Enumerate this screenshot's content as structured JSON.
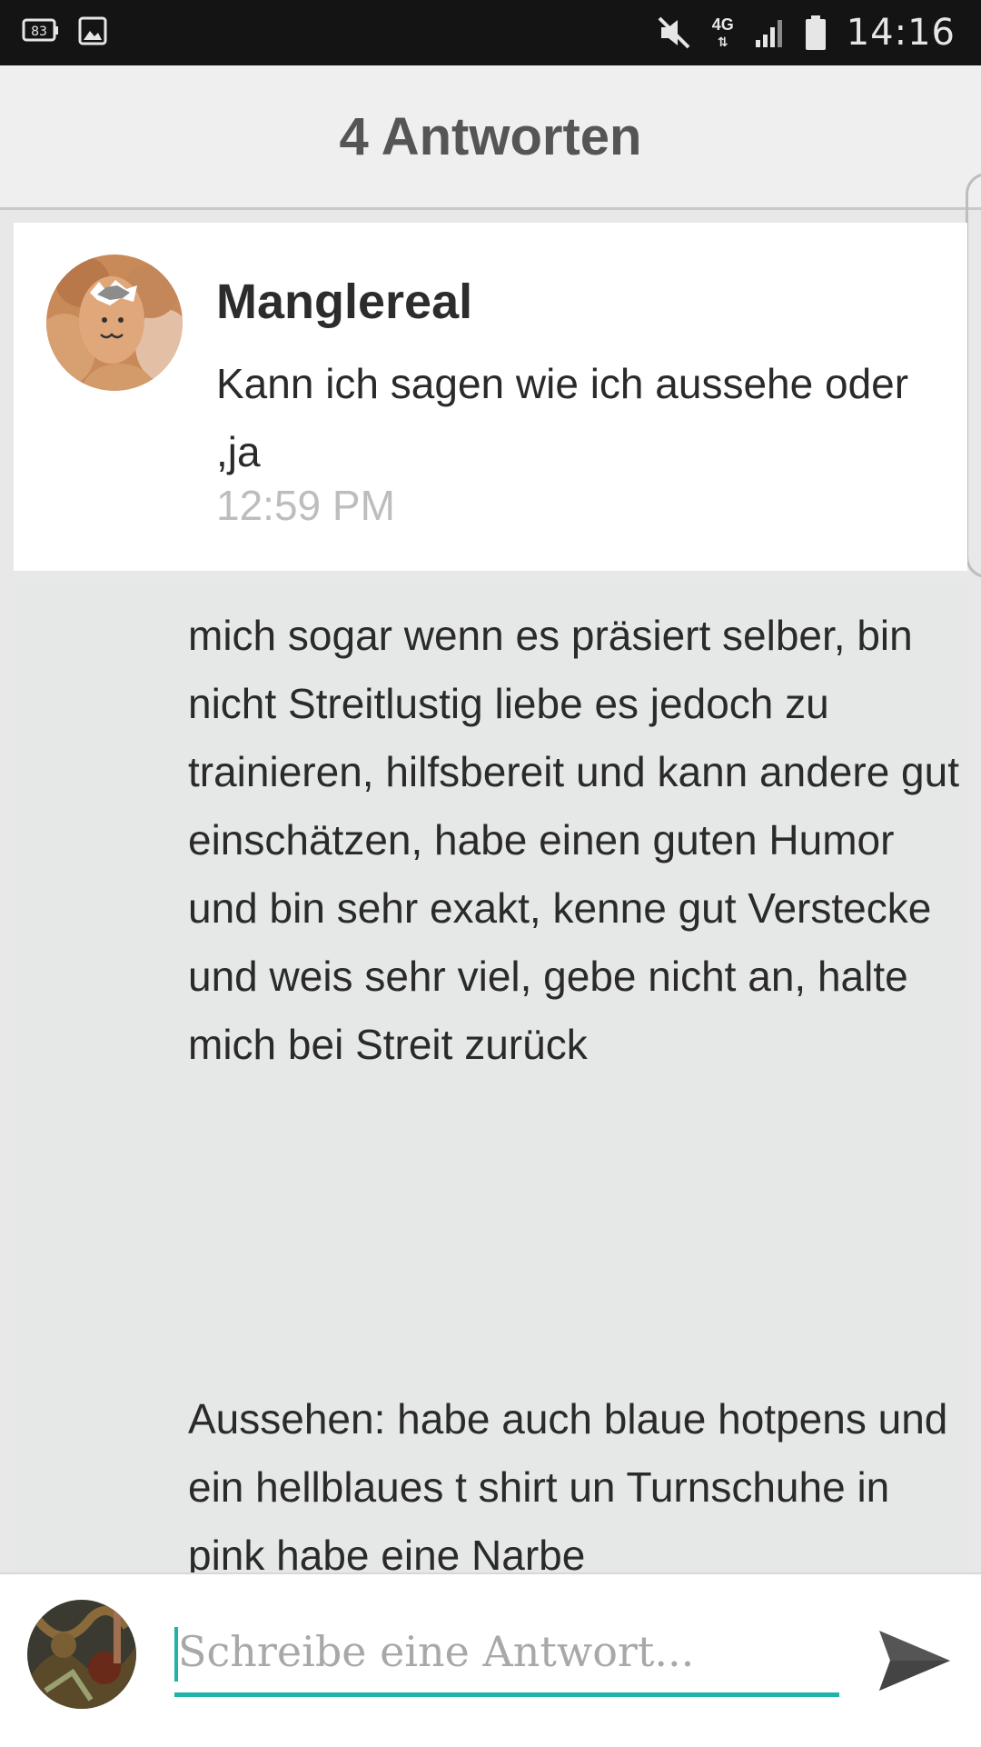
{
  "status_bar": {
    "left_badge": "83",
    "network": "4G",
    "time": "14:16"
  },
  "header": {
    "title": "4 Antworten"
  },
  "comment": {
    "author": "Manglereal",
    "text": "Kann ich sagen wie ich aussehe oder ,ja",
    "time": "12:59 PM"
  },
  "reply": {
    "paragraph1": "mich sogar wenn es präsiert selber, bin nicht Streitlustig liebe es jedoch zu trainieren, hilfsbereit und kann andere gut einschätzen, habe einen guten Humor und bin sehr exakt, kenne gut Verstecke und weis sehr viel, gebe nicht an, halte mich bei Streit zurück",
    "paragraph2": "Aussehen: habe auch blaue hotpens und ein hellblaues t shirt un Turnschuhe in pink habe eine Narbe"
  },
  "composer": {
    "placeholder": "Schreibe eine Antwort..."
  },
  "icons": {
    "mute": "mute-icon",
    "signal": "signal-icon",
    "battery": "battery-icon",
    "send": "send-icon",
    "image": "image-icon"
  },
  "colors": {
    "accent": "#1fb3a9",
    "status_bar": "#141414",
    "header_bg": "#efefef"
  }
}
